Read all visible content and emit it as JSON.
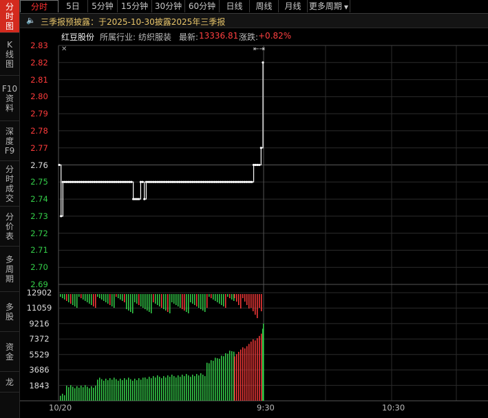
{
  "sidebar": {
    "tabs": [
      {
        "label": "分时图",
        "chars": [
          "分",
          "时",
          "图"
        ],
        "active": true
      },
      {
        "label": "K线图",
        "chars": [
          "K",
          "线",
          "图"
        ],
        "active": false
      },
      {
        "label": "F10资料",
        "chars": [
          "F10",
          "资",
          "料"
        ],
        "active": false
      },
      {
        "label": "深度F9",
        "chars": [
          "深",
          "度",
          "F9"
        ],
        "active": false
      },
      {
        "label": "分时成交",
        "chars": [
          "分",
          "时",
          "成",
          "交"
        ],
        "active": false
      },
      {
        "label": "分价表",
        "chars": [
          "分",
          "价",
          "表"
        ],
        "active": false
      },
      {
        "label": "多周期",
        "chars": [
          "多",
          "周",
          "期"
        ],
        "active": false
      },
      {
        "label": "多股",
        "chars": [
          "多",
          "股"
        ],
        "active": false
      },
      {
        "label": "资金",
        "chars": [
          "资",
          "金"
        ],
        "active": false
      },
      {
        "label": "龙",
        "chars": [
          "龙"
        ],
        "active": false
      }
    ]
  },
  "toolbar": {
    "tabs": [
      "分时",
      "5日",
      "5分钟",
      "15分钟",
      "30分钟",
      "60分钟",
      "日线",
      "周线",
      "月线",
      "更多周期"
    ],
    "active": "分时"
  },
  "notice": {
    "icon": "speaker-icon",
    "text": "三季报预披露：于2025-10-30披露2025年三季报"
  },
  "quote": {
    "name": "红豆股份",
    "industry_label": "所属行业:",
    "industry": "纺织服装",
    "latest_label": "最新:",
    "latest": "13336.81",
    "change_label": "涨跌:",
    "change": "+0.82%"
  },
  "colors": {
    "up": "#ff3b3b",
    "down": "#35d04a",
    "price_line": "#ffffff",
    "grid": "#2c2c2c",
    "notice_text": "#e8c56a"
  },
  "price_axis": {
    "ticks": [
      "2.83",
      "2.82",
      "2.81",
      "2.80",
      "2.79",
      "2.78",
      "2.77",
      "2.76",
      "2.75",
      "2.74",
      "2.73",
      "2.72",
      "2.71",
      "2.70",
      "2.69"
    ],
    "base": "2.76"
  },
  "volume_axis": {
    "ticks": [
      "12902",
      "11059",
      "9216",
      "7372",
      "5529",
      "3686",
      "1843"
    ]
  },
  "x_axis": {
    "labels": [
      "10/20",
      "9:30",
      "10:30"
    ]
  },
  "chart_data": {
    "type": "line",
    "price_range": [
      2.69,
      2.83
    ],
    "volume_max": 12902,
    "price": [
      2.76,
      2.73,
      2.75,
      2.75,
      2.75,
      2.75,
      2.75,
      2.75,
      2.75,
      2.75,
      2.75,
      2.75,
      2.75,
      2.75,
      2.75,
      2.75,
      2.75,
      2.75,
      2.75,
      2.75,
      2.75,
      2.75,
      2.75,
      2.75,
      2.75,
      2.75,
      2.75,
      2.75,
      2.75,
      2.75,
      2.75,
      2.75,
      2.75,
      2.75,
      2.75,
      2.75,
      2.75,
      2.75,
      2.75,
      2.75,
      2.74,
      2.74,
      2.74,
      2.74,
      2.75,
      2.75,
      2.74,
      2.75,
      2.75,
      2.75,
      2.75,
      2.75,
      2.75,
      2.75,
      2.75,
      2.75,
      2.75,
      2.75,
      2.75,
      2.75,
      2.75,
      2.75,
      2.75,
      2.75,
      2.75,
      2.75,
      2.75,
      2.75,
      2.75,
      2.75,
      2.75,
      2.75,
      2.75,
      2.75,
      2.75,
      2.75,
      2.75,
      2.75,
      2.75,
      2.75,
      2.75,
      2.75,
      2.75,
      2.75,
      2.75,
      2.75,
      2.75,
      2.75,
      2.75,
      2.75,
      2.75,
      2.75,
      2.75,
      2.75,
      2.75,
      2.75,
      2.75,
      2.75,
      2.75,
      2.75,
      2.75,
      2.75,
      2.75,
      2.75,
      2.75,
      2.76,
      2.76,
      2.76,
      2.76,
      2.77,
      2.82
    ],
    "volume_up": [
      1000,
      1100,
      1200,
      1300,
      1500,
      1700,
      1900,
      2100,
      2300,
      2500,
      2700,
      2900,
      3100,
      3300,
      3500,
      3700,
      3900,
      4100,
      4300,
      4500,
      4700,
      4900,
      5100,
      5300,
      5500,
      5800,
      6100,
      6400,
      6700,
      7000,
      7300,
      7600,
      8000,
      8400,
      9216
    ]
  }
}
